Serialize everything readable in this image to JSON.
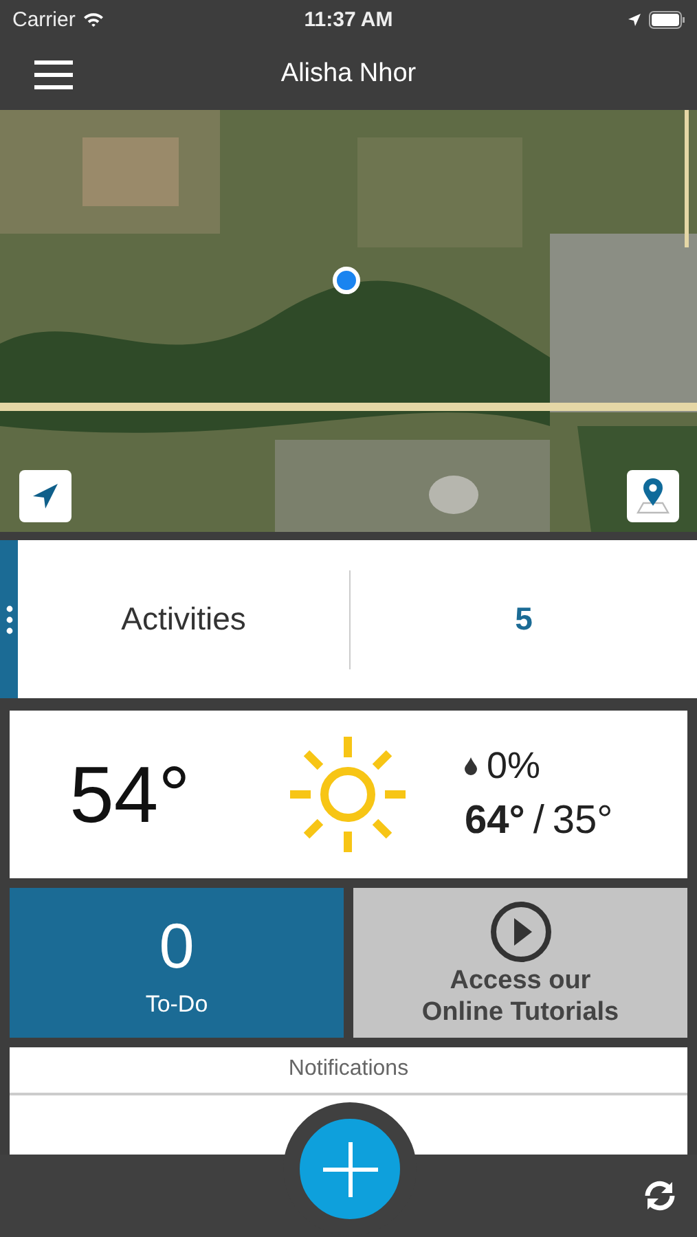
{
  "status_bar": {
    "carrier": "Carrier",
    "time": "11:37 AM"
  },
  "nav": {
    "title": "Alisha Nhor"
  },
  "activities": {
    "label": "Activities",
    "count": "5"
  },
  "weather": {
    "temperature": "54°",
    "precipitation": "0%",
    "high": "64°",
    "separator": "/",
    "low": "35°"
  },
  "todo": {
    "count": "0",
    "label": "To-Do"
  },
  "tutorials": {
    "label": "Access our Online Tutorials"
  },
  "notifications": {
    "title": "Notifications"
  }
}
